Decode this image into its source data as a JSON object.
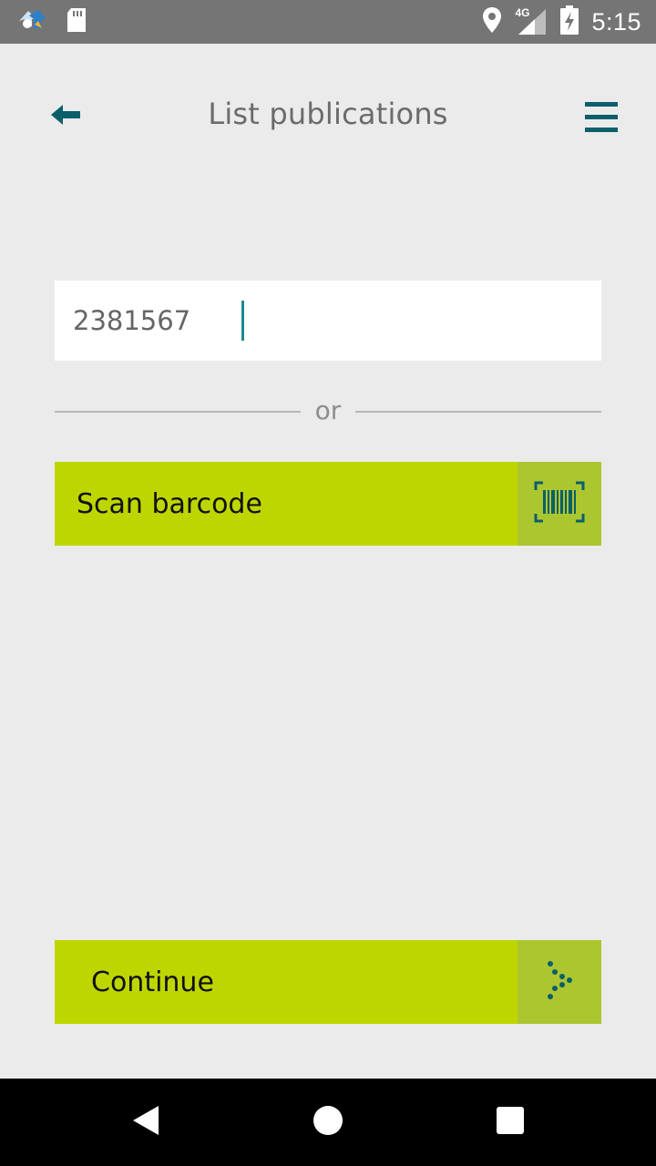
{
  "status_bar": {
    "time": "5:15",
    "network": "4G",
    "icons": [
      "app-notification-icon",
      "sd-card-icon",
      "location-icon",
      "signal-icon",
      "battery-charging-icon"
    ]
  },
  "header": {
    "title": "List publications",
    "back_icon": "arrow-left-icon",
    "menu_icon": "hamburger-menu-icon"
  },
  "barcode_field": {
    "value": "2381567",
    "placeholder": ""
  },
  "divider": {
    "label": "or"
  },
  "scan_button": {
    "label": "Scan barcode",
    "icon": "barcode-scan-icon"
  },
  "continue_button": {
    "label": "Continue",
    "icon": "dotted-arrow-right-icon"
  },
  "colors": {
    "accent": "#bed600",
    "accent_icon_box": "#acc62f",
    "teal": "#0b5f6b",
    "background": "#ebebeb",
    "status_bar": "#757575"
  },
  "nav_bar": {
    "buttons": [
      "back-triangle-icon",
      "home-circle-icon",
      "recents-square-icon"
    ]
  }
}
